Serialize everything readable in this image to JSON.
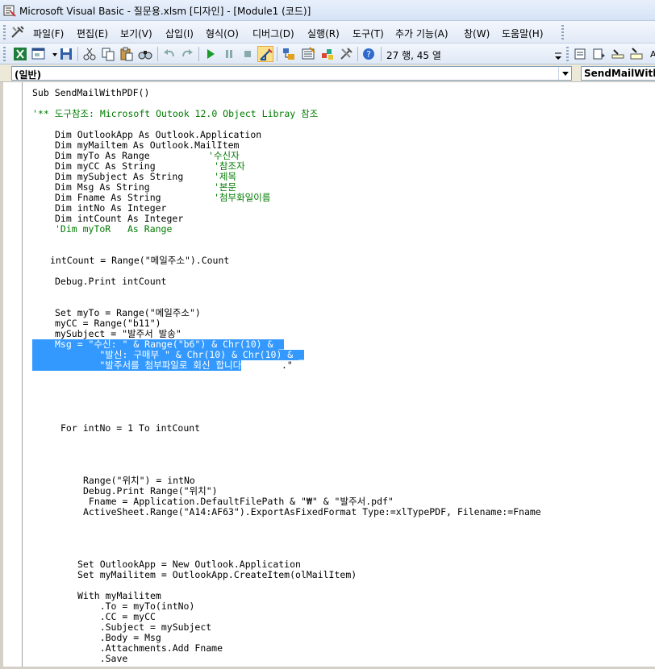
{
  "window": {
    "title": "Microsoft Visual Basic - 질문용.xlsm [디자인] - [Module1 (코드)]",
    "ghost_right": "  ..."
  },
  "menu": {
    "items": [
      "파일(F)",
      "편집(E)",
      "보기(V)",
      "삽입(I)",
      "형식(O)",
      "디버그(D)",
      "실행(R)",
      "도구(T)",
      "추가 기능(A)",
      "창(W)",
      "도움말(H)"
    ]
  },
  "toolbar": {
    "cursor_position": "27 행, 45 열",
    "icons": [
      "excel-icon",
      "insert-userform-icon",
      "save-icon",
      "cut-icon",
      "copy-icon",
      "paste-icon",
      "find-icon",
      "undo-icon",
      "redo-icon",
      "run-icon",
      "break-icon",
      "reset-icon",
      "design-mode-icon",
      "project-explorer-icon",
      "properties-icon",
      "object-browser-icon",
      "toolbox-icon",
      "help-icon"
    ]
  },
  "combos": {
    "object": "(일반)",
    "procedure": "SendMailWithPDF"
  },
  "colors": {
    "comment": "#007a00",
    "selection": "#3399ff"
  },
  "code": {
    "l1": "Sub SendMailWithPDF()",
    "l2": "'** 도구참조: Microsoft Outook 12.0 Object Libray 참조",
    "l3": "Dim OutlookApp As Outlook.Application",
    "l4": "Dim myMailtem As Outlook.MailItem",
    "l5a": "Dim myTo As Range",
    "l5c": "'수신자",
    "l6a": "Dim myCC As String",
    "l6c": "'참조자",
    "l7a": "Dim mySubject As String",
    "l7c": "'제목",
    "l8a": "Dim Msg As String",
    "l8c": "'본문",
    "l9a": "Dim Fname As String",
    "l9c": "'첨부화일이름",
    "l10": "Dim intNo As Integer",
    "l11": "Dim intCount As Integer",
    "l12": "'Dim myToR   As Range",
    "l13": "intCount = Range(\"메일주소\").Count",
    "l14": "Debug.Print intCount",
    "l15": "Set myTo = Range(\"메일주소\")",
    "l16": "myCC = Range(\"b11\")",
    "l17": "mySubject = \"발주서 발송\"",
    "l18": "Msg = \"수신: \" & Range(\"b6\") & Chr(10) & _",
    "l19": "        \"발신: 구매부 \" & Chr(10) & Chr(10) & _",
    "l20a": "        \"발주서를 첨부파일로 회신 합니다",
    "l20b": ".\"",
    "l21": "For intNo = 1 To intCount",
    "l22": "Range(\"위치\") = intNo",
    "l23": "Debug.Print Range(\"위치\")",
    "l24": " Fname = Application.DefaultFilePath & \"₩\" & \"발주서.pdf\"",
    "l25": "ActiveSheet.Range(\"A14:AF63\").ExportAsFixedFormat Type:=xlTypePDF, Filename:=Fname",
    "l26": "Set OutlookApp = New Outlook.Application",
    "l27": "Set myMailitem = OutlookApp.CreateItem(olMailItem)",
    "l28": "With myMailitem",
    "l29": "    .To = myTo(intNo)",
    "l30": "    .CC = myCC",
    "l31": "    .Subject = mySubject",
    "l32": "    .Body = Msg",
    "l33": "    .Attachments.Add Fname",
    "l34": "    .Save"
  }
}
